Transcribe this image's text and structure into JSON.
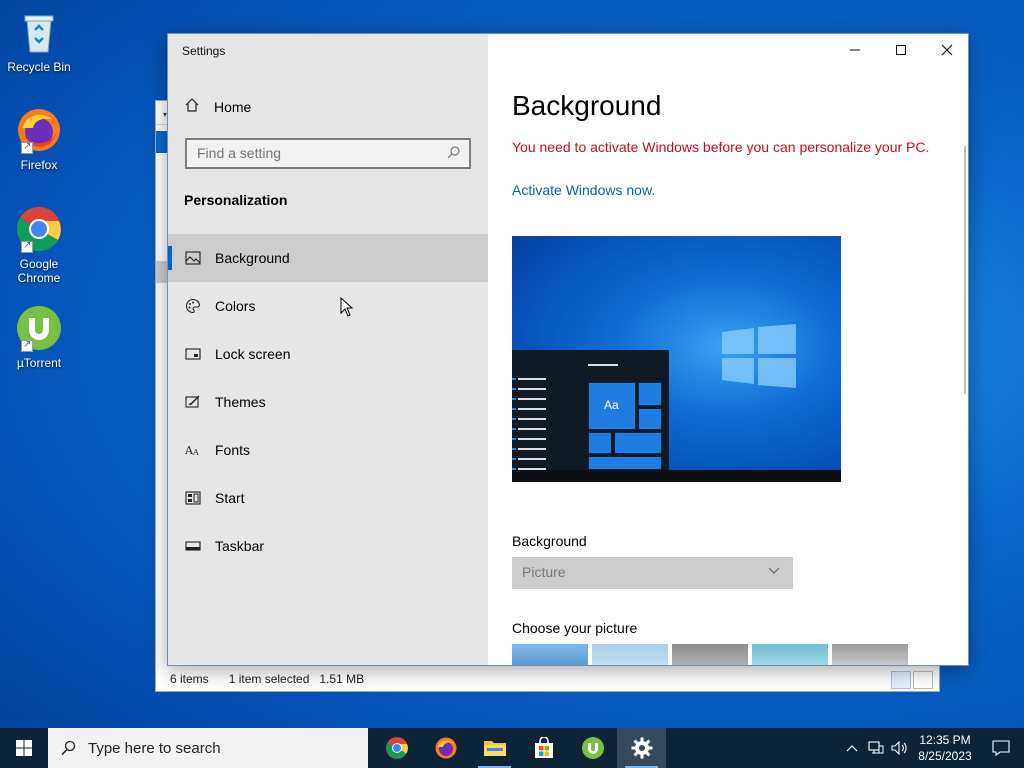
{
  "desktop": {
    "icons": [
      {
        "label": "Recycle Bin",
        "icon": "recycle-bin-icon"
      },
      {
        "label": "Firefox",
        "icon": "firefox-icon"
      },
      {
        "label": "Google Chrome",
        "icon": "chrome-icon"
      },
      {
        "label": "µTorrent",
        "icon": "utorrent-icon"
      }
    ]
  },
  "explorer": {
    "status": {
      "items": "6 items",
      "selected": "1 item selected",
      "size": "1.51 MB"
    }
  },
  "settings": {
    "app_title": "Settings",
    "home_label": "Home",
    "search_placeholder": "Find a setting",
    "section": "Personalization",
    "nav": [
      {
        "label": "Background",
        "icon": "picture-icon",
        "active": true
      },
      {
        "label": "Colors",
        "icon": "palette-icon"
      },
      {
        "label": "Lock screen",
        "icon": "lock-screen-icon"
      },
      {
        "label": "Themes",
        "icon": "themes-icon"
      },
      {
        "label": "Fonts",
        "icon": "fonts-icon"
      },
      {
        "label": "Start",
        "icon": "start-icon"
      },
      {
        "label": "Taskbar",
        "icon": "taskbar-icon"
      }
    ],
    "content": {
      "title": "Background",
      "warning": "You need to activate Windows before you can personalize your PC.",
      "activate_link": "Activate Windows now.",
      "preview_sample": "Aa",
      "background_label": "Background",
      "background_value": "Picture",
      "choose_label": "Choose your picture"
    }
  },
  "taskbar": {
    "search_placeholder": "Type here to search",
    "apps": [
      {
        "name": "chrome-icon",
        "open": false
      },
      {
        "name": "firefox-icon",
        "open": false
      },
      {
        "name": "file-explorer-icon",
        "open": true
      },
      {
        "name": "store-icon",
        "open": false
      },
      {
        "name": "utorrent-icon",
        "open": false
      },
      {
        "name": "settings-icon",
        "open": true,
        "active": true
      }
    ],
    "time": "12:35 PM",
    "date": "8/25/2023"
  },
  "colors": {
    "accent": "#0067c0",
    "warning": "#c50f1f",
    "link": "#0063b1",
    "taskbar": "#0c2436"
  }
}
